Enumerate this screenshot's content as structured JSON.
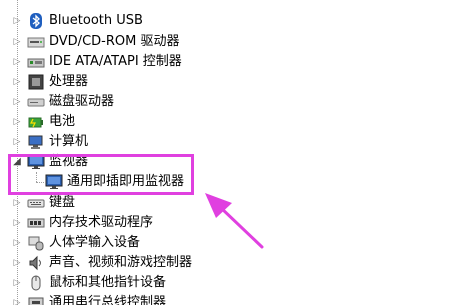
{
  "tree": {
    "items": [
      {
        "label": "Bluetooth USB",
        "icon": "bluetooth-icon",
        "expander": "▷"
      },
      {
        "label": "DVD/CD-ROM 驱动器",
        "icon": "dvd-drive-icon",
        "expander": "▷"
      },
      {
        "label": "IDE ATA/ATAPI 控制器",
        "icon": "ide-controller-icon",
        "expander": "▷"
      },
      {
        "label": "处理器",
        "icon": "processor-icon",
        "expander": "▷"
      },
      {
        "label": "磁盘驱动器",
        "icon": "disk-drive-icon",
        "expander": "▷"
      },
      {
        "label": "电池",
        "icon": "battery-icon",
        "expander": "▷"
      },
      {
        "label": "计算机",
        "icon": "computer-icon",
        "expander": "▷"
      },
      {
        "label": "监视器",
        "icon": "monitor-icon",
        "expander": "◢"
      },
      {
        "label": "通用即插即用监视器",
        "icon": "monitor-icon",
        "child": true
      },
      {
        "label": "键盘",
        "icon": "keyboard-icon",
        "expander": "▷"
      },
      {
        "label": "内存技术驱动程序",
        "icon": "memory-icon",
        "expander": "▷"
      },
      {
        "label": "人体学输入设备",
        "icon": "hid-icon",
        "expander": "▷"
      },
      {
        "label": "声音、视频和游戏控制器",
        "icon": "sound-icon",
        "expander": "▷"
      },
      {
        "label": "鼠标和其他指针设备",
        "icon": "mouse-icon",
        "expander": "▷"
      },
      {
        "label": "通用串行总线控制器",
        "icon": "usb-icon",
        "expander": "▷"
      }
    ]
  },
  "annotation": {
    "highlight_color": "#e040e0"
  }
}
